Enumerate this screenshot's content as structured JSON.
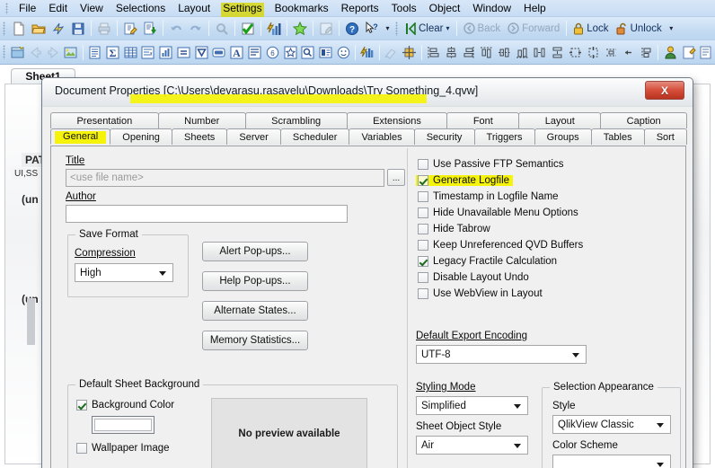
{
  "app": {
    "menu": [
      {
        "label": "File",
        "highlighted": false
      },
      {
        "label": "Edit",
        "highlighted": false
      },
      {
        "label": "View",
        "highlighted": false
      },
      {
        "label": "Selections",
        "highlighted": false
      },
      {
        "label": "Layout",
        "highlighted": false
      },
      {
        "label": "Settings",
        "highlighted": true
      },
      {
        "label": "Bookmarks",
        "highlighted": false
      },
      {
        "label": "Reports",
        "highlighted": false
      },
      {
        "label": "Tools",
        "highlighted": false
      },
      {
        "label": "Object",
        "highlighted": false
      },
      {
        "label": "Window",
        "highlighted": false
      },
      {
        "label": "Help",
        "highlighted": false
      }
    ],
    "toolbar_row1": {
      "icons": [
        "new-document-icon",
        "open-folder-icon",
        "reload-icon",
        "save-icon",
        "print-icon",
        "edit-script-icon",
        "export-icon",
        "undo-icon",
        "redo-icon",
        "search-icon",
        "current-selections-icon",
        "charts-icon",
        "favorites-icon",
        "edit-module-icon",
        "help-icon",
        "context-help-icon"
      ],
      "clear_label": "Clear",
      "back_label": "Back",
      "forward_label": "Forward",
      "lock_label": "Lock",
      "unlock_label": "Unlock"
    },
    "toolbar_row2": {
      "icons": [
        "new-sheet-icon",
        "previous-sheet-icon",
        "next-sheet-icon",
        "sheet-properties-icon",
        "list-box-icon",
        "statistics-box-icon",
        "table-box-icon",
        "multi-box-icon",
        "chart-icon",
        "input-box-icon",
        "current-selections-box-icon",
        "button-icon",
        "text-object-icon",
        "line-arrow-icon",
        "slider-calendar-icon",
        "bookmark-object-icon",
        "search-object-icon",
        "container-icon",
        "custom-object-icon",
        "system-table-icon",
        "format-painter-icon",
        "grid-icon",
        "align-left-icon",
        "align-center-h-icon",
        "align-right-icon",
        "align-top-icon",
        "align-middle-icon",
        "align-bottom-icon",
        "space-horizontally-icon",
        "space-vertically-icon",
        "resize-width-icon",
        "shrink-icon",
        "stretch-icon",
        "user-icon",
        "design-grid-icon",
        "object-icon"
      ]
    }
  },
  "sheet": {
    "tab_label": "Sheet1",
    "objects": [
      {
        "name": "PAT",
        "text": "PAT"
      },
      {
        "name": "UI,SS",
        "text": "UI,SS"
      },
      {
        "name": "unavailable-1",
        "text": "(un"
      },
      {
        "name": "unavailable-2",
        "text": "(un"
      }
    ]
  },
  "dialog": {
    "title": "Document Properties [C:\\Users\\devarasu.rasavelu\\Downloads\\Try Something_4.qvw]",
    "close_label": "X",
    "tabs_row1": [
      {
        "label": "Presentation",
        "selected": false
      },
      {
        "label": "Number",
        "selected": false
      },
      {
        "label": "Scrambling",
        "selected": false
      },
      {
        "label": "Extensions",
        "selected": false
      },
      {
        "label": "Font",
        "selected": false
      },
      {
        "label": "Layout",
        "selected": false
      },
      {
        "label": "Caption",
        "selected": false
      }
    ],
    "tabs_row2": [
      {
        "label": "General",
        "selected": true,
        "highlighted": true
      },
      {
        "label": "Opening",
        "selected": false,
        "highlighted": false
      },
      {
        "label": "Sheets",
        "selected": false,
        "highlighted": false
      },
      {
        "label": "Server",
        "selected": false,
        "highlighted": false
      },
      {
        "label": "Scheduler",
        "selected": false,
        "highlighted": false
      },
      {
        "label": "Variables",
        "selected": false,
        "highlighted": false
      },
      {
        "label": "Security",
        "selected": false,
        "highlighted": false
      },
      {
        "label": "Triggers",
        "selected": false,
        "highlighted": false
      },
      {
        "label": "Groups",
        "selected": false,
        "highlighted": false
      },
      {
        "label": "Tables",
        "selected": false,
        "highlighted": false
      },
      {
        "label": "Sort",
        "selected": false,
        "highlighted": false
      }
    ],
    "general": {
      "title_label": "Title",
      "title_value": "",
      "title_placeholder": "<use file name>",
      "title_browse_label": "...",
      "author_label": "Author",
      "author_value": "",
      "save_format_group": "Save Format",
      "compression_label": "Compression",
      "compression_value": "High",
      "buttons": [
        {
          "name": "alert-popups-button",
          "label": "Alert Pop-ups..."
        },
        {
          "name": "help-popups-button",
          "label": "Help Pop-ups..."
        },
        {
          "name": "alternate-states-button",
          "label": "Alternate States..."
        },
        {
          "name": "memory-statistics-button",
          "label": "Memory Statistics..."
        }
      ],
      "checkboxes": [
        {
          "name": "use-passive-ftp-semantics",
          "label": "Use Passive FTP Semantics",
          "checked": false,
          "highlighted": false
        },
        {
          "name": "generate-logfile",
          "label": "Generate Logfile",
          "checked": true,
          "highlighted": true
        },
        {
          "name": "timestamp-in-logfile-name",
          "label": "Timestamp in Logfile Name",
          "checked": false,
          "highlighted": false
        },
        {
          "name": "hide-unavailable-menu-options",
          "label": "Hide Unavailable Menu Options",
          "checked": false,
          "highlighted": false
        },
        {
          "name": "hide-tabrow",
          "label": "Hide Tabrow",
          "checked": false,
          "highlighted": false
        },
        {
          "name": "keep-unreferenced-qvd-buffers",
          "label": "Keep Unreferenced QVD Buffers",
          "checked": false,
          "highlighted": false
        },
        {
          "name": "legacy-fractile-calculation",
          "label": "Legacy Fractile Calculation",
          "checked": true,
          "highlighted": false
        },
        {
          "name": "disable-layout-undo",
          "label": "Disable Layout Undo",
          "checked": false,
          "highlighted": false
        },
        {
          "name": "use-webview-in-layout",
          "label": "Use WebView in Layout",
          "checked": false,
          "highlighted": false
        }
      ],
      "export_encoding_label": "Default Export Encoding",
      "export_encoding_value": "UTF-8",
      "styling_mode_label": "Styling Mode",
      "styling_mode_value": "Simplified",
      "sheet_object_style_label": "Sheet Object Style",
      "sheet_object_style_value": "Air",
      "selection_appearance_group": "Selection Appearance",
      "style_label": "Style",
      "style_value": "QlikView Classic",
      "color_scheme_label": "Color Scheme",
      "sheet_background_group": "Default Sheet Background",
      "background_color_label": "Background Color",
      "background_color_checked": true,
      "background_color_value": "#ffffff",
      "wallpaper_image_label": "Wallpaper Image",
      "wallpaper_image_checked": false,
      "preview_text": "No preview available"
    }
  },
  "colors": {
    "highlight": "#f5f30a",
    "menu_highlight": "#d7d712",
    "toolbar_top": "#dcebfa",
    "toolbar_bottom": "#bcd6f0",
    "dialog_bg": "#f0f0f0",
    "close_red": "#d6503b"
  }
}
